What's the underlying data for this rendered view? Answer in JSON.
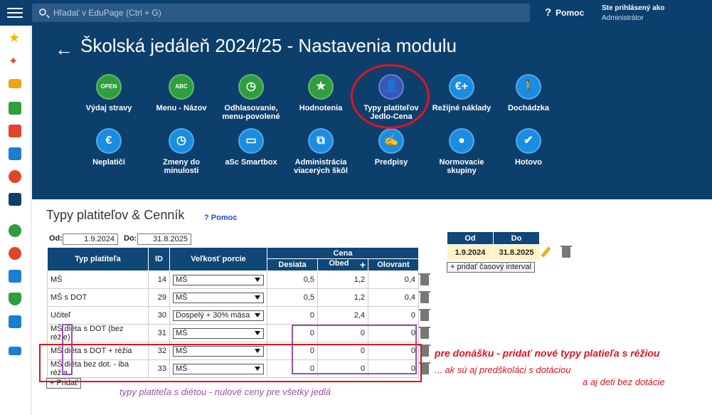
{
  "topbar": {
    "search_placeholder": "Hľadať v EduPage (Ctrl + G)",
    "help_label": "Pomoc",
    "user_line1": "Ste prihlásený ako",
    "user_line2": "Administrátor"
  },
  "page_title": "Školská jedáleň 2024/25 - Nastavenia modulu",
  "tiles_row1": [
    {
      "label": "Výdaj stravy",
      "color": "#2e9e3e",
      "glyph": "OPEN"
    },
    {
      "label": "Menu - Názov",
      "color": "#2e9e3e",
      "glyph": "ABC"
    },
    {
      "label": "Odhlasovanie, menu-povolené",
      "color": "#2e9e3e",
      "glyph": "◷"
    },
    {
      "label": "Hodnotenia",
      "color": "#2e9e3e",
      "glyph": "★"
    },
    {
      "label": "Typy platiteľov Jedlo-Cena",
      "color": "#3a55b8",
      "glyph": "👤"
    },
    {
      "label": "Režijné náklady",
      "color": "#1a8de0",
      "glyph": "€+"
    },
    {
      "label": "Dochádzka",
      "color": "#1a8de0",
      "glyph": "🚶"
    }
  ],
  "tiles_row2": [
    {
      "label": "Neplatiči",
      "color": "#1a8de0",
      "glyph": "€"
    },
    {
      "label": "Zmeny do minulosti",
      "color": "#1a8de0",
      "glyph": "◷"
    },
    {
      "label": "aSc Smartbox",
      "color": "#1a8de0",
      "glyph": "▭"
    },
    {
      "label": "Administrácia viacerých škôl",
      "color": "#1a8de0",
      "glyph": "⧉"
    },
    {
      "label": "Predpisy",
      "color": "#1a8de0",
      "glyph": "✍"
    },
    {
      "label": "Normovacie skupiny",
      "color": "#1a8de0",
      "glyph": "●"
    },
    {
      "label": "Hotovo",
      "color": "#1a8de0",
      "glyph": "✔"
    }
  ],
  "section": {
    "title": "Typy platiteľov & Cenník",
    "help": "Pomoc",
    "od_label": "Od:",
    "od_value": "1.9.2024",
    "do_label": "Do:",
    "do_value": "31.8.2025"
  },
  "table": {
    "headers": {
      "typ": "Typ platiteľa",
      "id": "ID",
      "velkost": "Veľkosť porcie",
      "cena": "Cena",
      "desiata": "Desiata",
      "obed": "Obed",
      "olovrant": "Olovrant",
      "plus": "+"
    },
    "rows": [
      {
        "typ": "MŠ",
        "id": "14",
        "velkost": "MŠ",
        "desiata": "0,5",
        "obed": "1,2",
        "olovrant": "0,4"
      },
      {
        "typ": "MŠ s DOT",
        "id": "29",
        "velkost": "MŠ",
        "desiata": "0,5",
        "obed": "1,2",
        "olovrant": "0,4"
      },
      {
        "typ": "Učiteľ",
        "id": "30",
        "velkost": "Dospelý + 30% mäsa",
        "desiata": "0",
        "obed": "2,4",
        "olovrant": "0"
      },
      {
        "typ": "MŠ diéta s DOT (bez réžie)",
        "id": "31",
        "velkost": "MŠ",
        "desiata": "0",
        "obed": "0",
        "olovrant": "0"
      },
      {
        "typ": "MŠ diéta s DOT + réžia",
        "id": "32",
        "velkost": "MŠ",
        "desiata": "0",
        "obed": "0",
        "olovrant": "0"
      },
      {
        "typ": "MŠ diéta bez dot. - iba réžia",
        "id": "33",
        "velkost": "MŠ",
        "desiata": "0",
        "obed": "0",
        "olovrant": "0"
      }
    ],
    "add_label": "+ Pridať"
  },
  "interval": {
    "od_header": "Od",
    "do_header": "Do",
    "od": "1.9.2024",
    "do": "31.8.2025",
    "add_label": "+ pridať časový interval"
  },
  "annotations": {
    "red1": "pre donášku - pridať nové typy platieľa s réžiou",
    "red2": "... ak sú aj predškoláci s dotáciou",
    "red3": "a aj deti bez dotácie",
    "purple": "typy platiteľa s diétou - nulové ceny pre všetky jedlá"
  },
  "colors": {
    "header_bg": "#0d3f6c",
    "red": "#e0141e",
    "purple": "#9b4fb1"
  }
}
